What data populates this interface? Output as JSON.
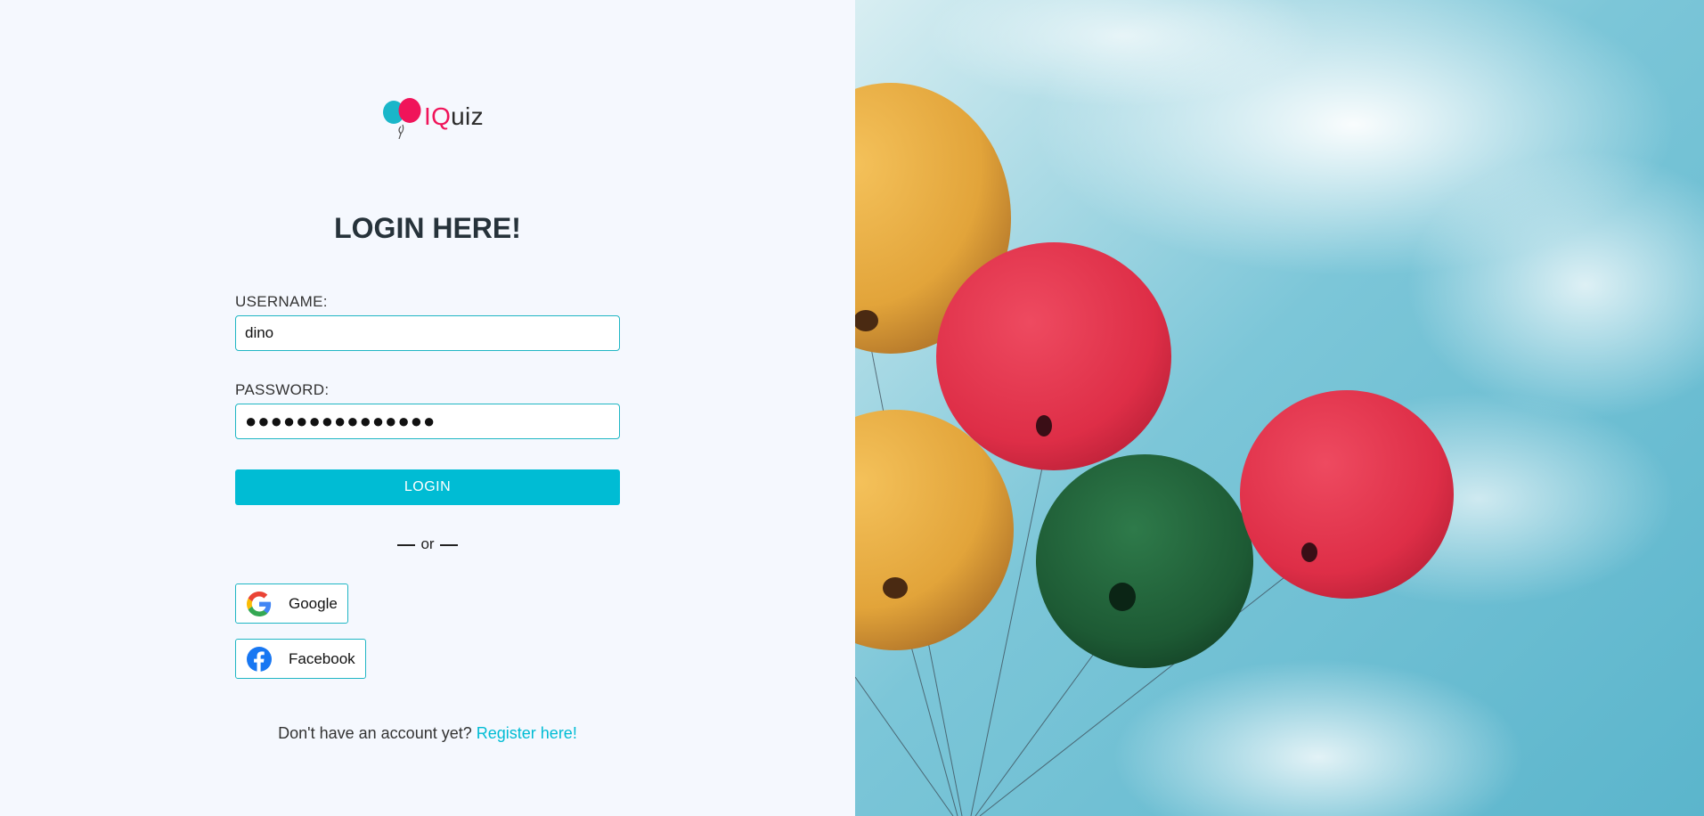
{
  "logo": {
    "brand_accent": "IQ",
    "brand_rest": "uiz",
    "icon": "balloons-logo-icon"
  },
  "form": {
    "title": "LOGIN HERE!",
    "username_label": "USERNAME:",
    "username_value": "dino",
    "password_label": "PASSWORD:",
    "password_value": "●●●●●●●●●●●●●●●",
    "login_label": "LOGIN",
    "or_text": "or"
  },
  "social": {
    "google_label": "Google",
    "facebook_label": "Facebook"
  },
  "register": {
    "prompt": "Don't have an account yet?",
    "link": "Register here!"
  },
  "colors": {
    "accent": "#00bcd4",
    "brand_pink": "#f0145a",
    "left_bg": "#f5f8fe",
    "border": "#1fb6c4"
  },
  "hero_image": {
    "icon": "balloons-sky-photo"
  }
}
